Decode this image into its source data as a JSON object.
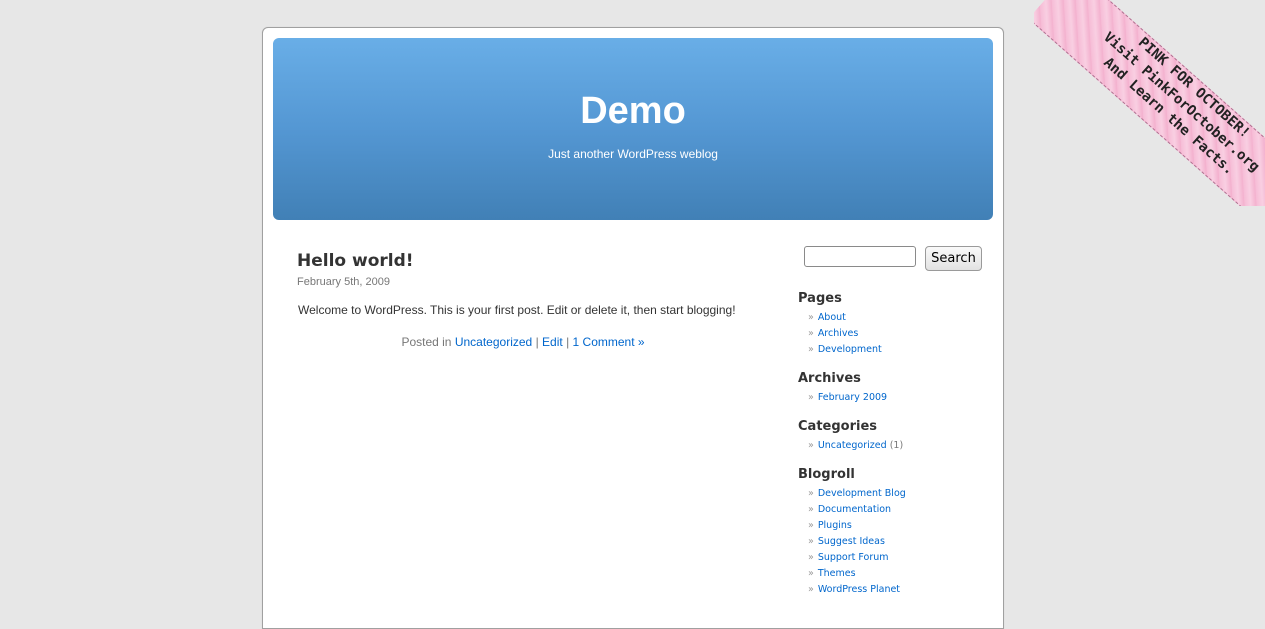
{
  "header": {
    "title": "Demo",
    "description": "Just another WordPress weblog"
  },
  "post": {
    "title": "Hello world!",
    "date": "February 5th, 2009",
    "entry": "Welcome to WordPress. This is your first post. Edit or delete it, then start blogging!",
    "meta_prefix": "Posted in",
    "category": "Uncategorized",
    "separator": "|",
    "edit": "Edit",
    "comments": "1 Comment »"
  },
  "search": {
    "value": "",
    "button": "Search"
  },
  "sidebar": {
    "bullet": "»",
    "pages": {
      "title": "Pages",
      "items": [
        "About",
        "Archives",
        "Development"
      ]
    },
    "archives": {
      "title": "Archives",
      "items": [
        "February 2009"
      ]
    },
    "categories": {
      "title": "Categories",
      "items": [
        {
          "label": "Uncategorized",
          "count": "(1)"
        }
      ]
    },
    "blogroll": {
      "title": "Blogroll",
      "items": [
        "Development Blog",
        "Documentation",
        "Plugins",
        "Suggest Ideas",
        "Support Forum",
        "Themes",
        "WordPress Planet"
      ]
    }
  },
  "ribbon": {
    "line1": "PINK FOR OCTOBER!",
    "line2": "Visit PinkForOctober.org",
    "line3": "And Learn the Facts."
  }
}
